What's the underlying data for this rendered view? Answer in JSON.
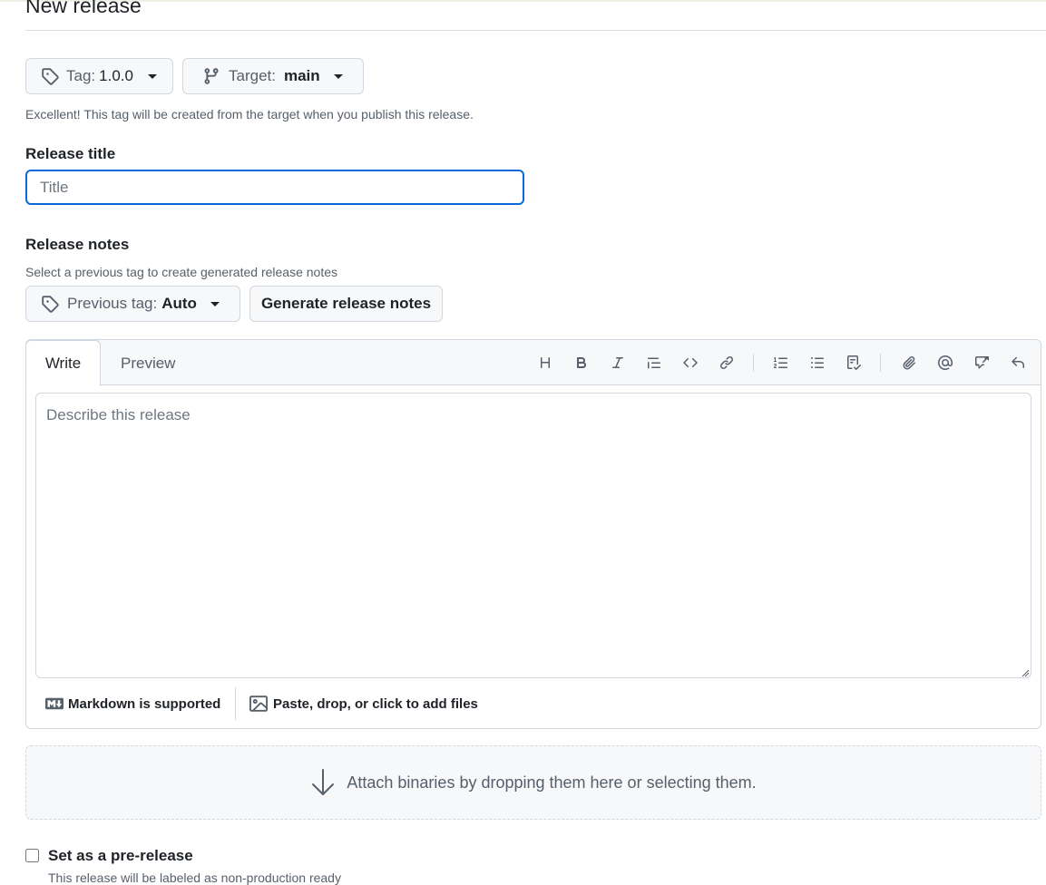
{
  "page": {
    "title": "New release"
  },
  "tag_button": {
    "label": "Tag:",
    "value": "1.0.0"
  },
  "target_button": {
    "label": "Target:",
    "value": "main"
  },
  "tag_hint": "Excellent! This tag will be created from the target when you publish this release.",
  "release_title": {
    "label": "Release title",
    "placeholder": "Title",
    "value": ""
  },
  "release_notes": {
    "label": "Release notes",
    "hint": "Select a previous tag to create generated release notes",
    "previous_tag": {
      "label": "Previous tag:",
      "value": "Auto"
    },
    "generate_label": "Generate release notes"
  },
  "editor": {
    "tabs": [
      {
        "label": "Write",
        "active": true
      },
      {
        "label": "Preview",
        "active": false
      }
    ],
    "toolbar": [
      "heading-icon",
      "bold-icon",
      "italic-icon",
      "quote-icon",
      "code-icon",
      "link-icon",
      "ordered-list-icon",
      "unordered-list-icon",
      "task-list-icon",
      "attach-icon",
      "mention-icon",
      "cross-reference-icon",
      "undo-icon"
    ],
    "placeholder": "Describe this release",
    "value": "",
    "markdown_label": "Markdown is supported",
    "attach_label": "Paste, drop, or click to add files"
  },
  "binaries": {
    "label": "Attach binaries by dropping them here or selecting them."
  },
  "prerelease": {
    "label": "Set as a pre-release",
    "hint": "This release will be labeled as non-production ready",
    "checked": false
  },
  "colors": {
    "accent": "#0969da",
    "border": "#d0d7de",
    "muted_text": "#57606a",
    "button_bg": "#f6f8fa"
  }
}
